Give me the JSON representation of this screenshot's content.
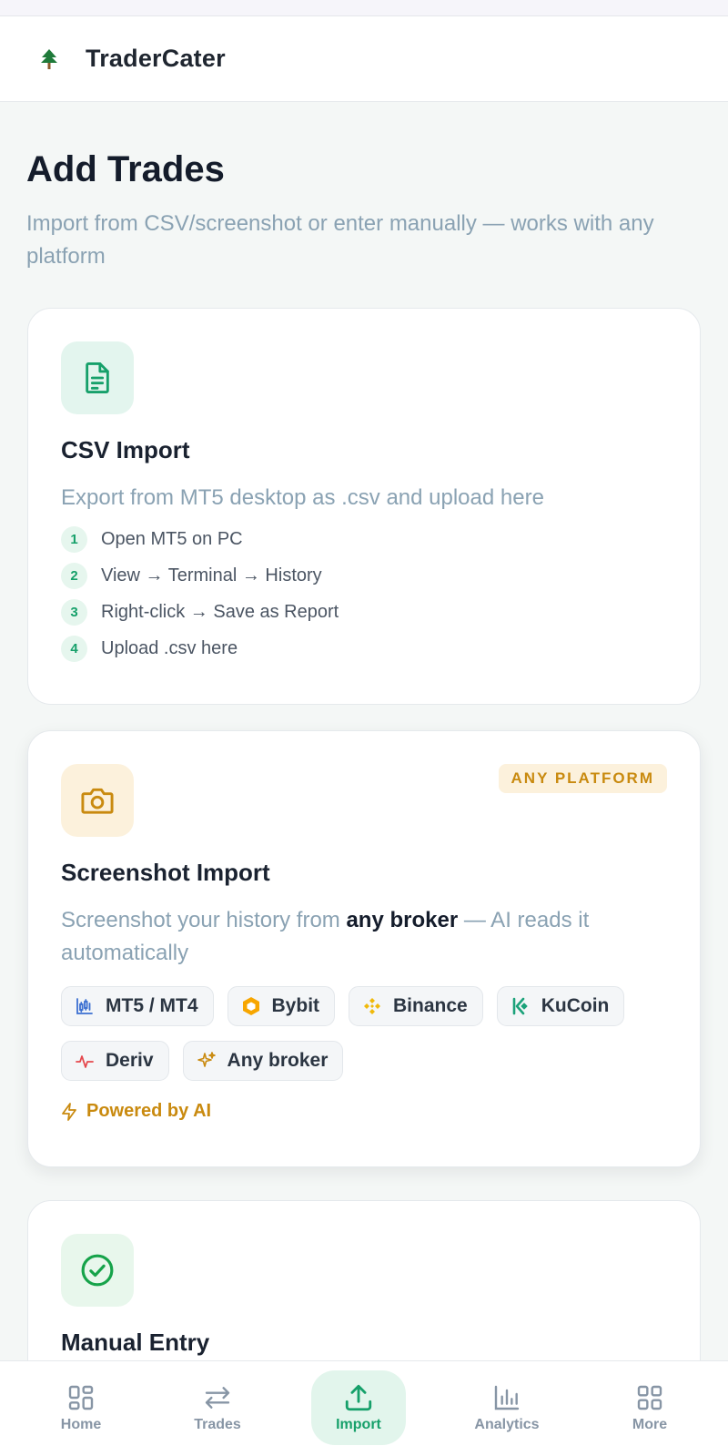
{
  "app": {
    "brand": "TraderCater"
  },
  "page": {
    "title": "Add Trades",
    "subtitle": "Import from CSV/screenshot or enter manually — works with any platform"
  },
  "csv": {
    "title": "CSV Import",
    "description": "Export from MT5 desktop as .csv and upload here",
    "steps": [
      {
        "num": "1",
        "text": "Open MT5 on PC"
      },
      {
        "num": "2",
        "text": "View → Terminal → History"
      },
      {
        "num": "3",
        "text": "Right-click → Save as Report"
      },
      {
        "num": "4",
        "text": "Upload .csv here"
      }
    ]
  },
  "screenshot": {
    "badge": "ANY PLATFORM",
    "title": "Screenshot Import",
    "desc_before": "Screenshot your history from ",
    "desc_bold": "any broker",
    "desc_after": " — AI reads it automatically",
    "chips": [
      {
        "label": "MT5 / MT4",
        "icon": "candlestick-icon"
      },
      {
        "label": "Bybit",
        "icon": "bybit-icon"
      },
      {
        "label": "Binance",
        "icon": "binance-icon"
      },
      {
        "label": "KuCoin",
        "icon": "kucoin-icon"
      },
      {
        "label": "Deriv",
        "icon": "pulse-icon"
      },
      {
        "label": "Any broker",
        "icon": "sparkles-icon"
      }
    ],
    "powered": "Powered by AI"
  },
  "manual": {
    "title": "Manual Entry"
  },
  "nav": {
    "items": [
      {
        "label": "Home",
        "icon": "grid-icon"
      },
      {
        "label": "Trades",
        "icon": "arrows-icon"
      },
      {
        "label": "Import",
        "icon": "upload-icon"
      },
      {
        "label": "Analytics",
        "icon": "bar-chart-icon"
      },
      {
        "label": "More",
        "icon": "apps-icon"
      }
    ],
    "active": "Import"
  },
  "colors": {
    "accent_green": "#16a06a",
    "accent_amber": "#c98a0f",
    "text_muted": "#8aa2b3"
  }
}
